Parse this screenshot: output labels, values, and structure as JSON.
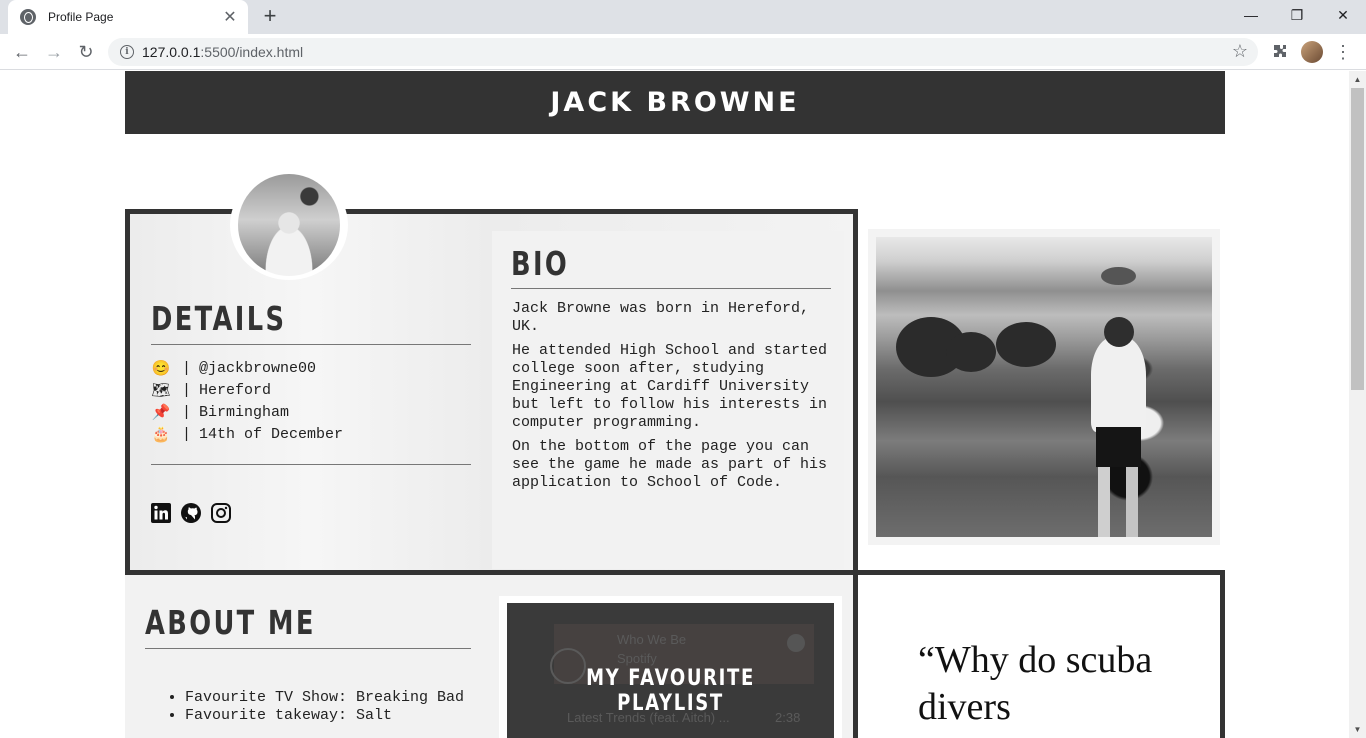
{
  "browser": {
    "tab_title": "Profile Page",
    "url_host": "127.0.0.1",
    "url_rest": ":5500/index.html"
  },
  "header": {
    "title": "JACK BROWNE"
  },
  "details": {
    "title": "DETAILS",
    "items": [
      {
        "icon": "smiling-face-icon",
        "glyph": "😊",
        "text": "@jackbrowne00"
      },
      {
        "icon": "world-map-icon",
        "glyph": "🗺",
        "text": "Hereford"
      },
      {
        "icon": "pushpin-icon",
        "glyph": "📌",
        "text": "Birmingham"
      },
      {
        "icon": "birthday-cake-icon",
        "glyph": "🎂",
        "text": "14th of December"
      }
    ],
    "separator": "|",
    "socials": [
      "linkedin-icon",
      "github-icon",
      "instagram-icon"
    ]
  },
  "bio": {
    "title": "BIO",
    "paragraphs": [
      "Jack Browne was born in Hereford, UK.",
      "He attended High School and started college soon after, studying Engineering at Cardiff University but left to follow his interests in computer programming.",
      "On the bottom of the page you can see the game he made as part of his application to School of Code."
    ]
  },
  "about": {
    "title": "ABOUT ME",
    "items": [
      "Favourite TV Show: Breaking Bad",
      "Favourite takeway: Salt"
    ]
  },
  "playlist": {
    "title": "MY FAVOURITE PLAYLIST",
    "ghost_name": "Who We Be",
    "ghost_source": "Spotify",
    "ghost_track": "Latest Trends (feat. Aitch) ...",
    "ghost_duration": "2:38"
  },
  "quote": {
    "text": "“Why do scuba divers"
  },
  "colors": {
    "dark": "#333333",
    "panel": "#f2f2f2"
  }
}
